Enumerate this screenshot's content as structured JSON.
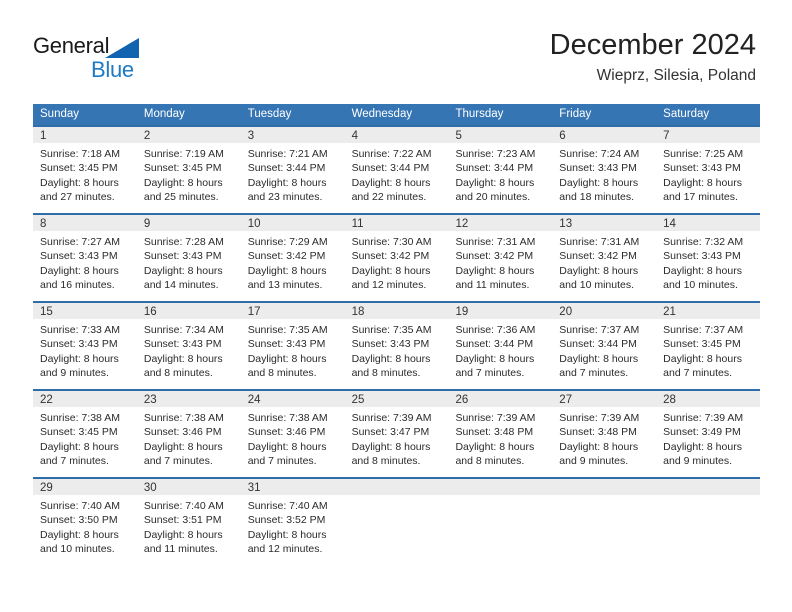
{
  "brand": {
    "name_top": "General",
    "name_bottom": "Blue",
    "accent_color": "#1f7ac4",
    "triangle_color": "#1263b0"
  },
  "header": {
    "title": "December 2024",
    "subtitle": "Wieprz, Silesia, Poland"
  },
  "calendar": {
    "header_bg": "#3575b4",
    "daynum_bg": "#ececec",
    "daynum_border": "#2f6da8",
    "weekdays": [
      "Sunday",
      "Monday",
      "Tuesday",
      "Wednesday",
      "Thursday",
      "Friday",
      "Saturday"
    ],
    "weeks": [
      [
        {
          "day": "1",
          "sunrise": "Sunrise: 7:18 AM",
          "sunset": "Sunset: 3:45 PM",
          "daylight1": "Daylight: 8 hours",
          "daylight2": "and 27 minutes."
        },
        {
          "day": "2",
          "sunrise": "Sunrise: 7:19 AM",
          "sunset": "Sunset: 3:45 PM",
          "daylight1": "Daylight: 8 hours",
          "daylight2": "and 25 minutes."
        },
        {
          "day": "3",
          "sunrise": "Sunrise: 7:21 AM",
          "sunset": "Sunset: 3:44 PM",
          "daylight1": "Daylight: 8 hours",
          "daylight2": "and 23 minutes."
        },
        {
          "day": "4",
          "sunrise": "Sunrise: 7:22 AM",
          "sunset": "Sunset: 3:44 PM",
          "daylight1": "Daylight: 8 hours",
          "daylight2": "and 22 minutes."
        },
        {
          "day": "5",
          "sunrise": "Sunrise: 7:23 AM",
          "sunset": "Sunset: 3:44 PM",
          "daylight1": "Daylight: 8 hours",
          "daylight2": "and 20 minutes."
        },
        {
          "day": "6",
          "sunrise": "Sunrise: 7:24 AM",
          "sunset": "Sunset: 3:43 PM",
          "daylight1": "Daylight: 8 hours",
          "daylight2": "and 18 minutes."
        },
        {
          "day": "7",
          "sunrise": "Sunrise: 7:25 AM",
          "sunset": "Sunset: 3:43 PM",
          "daylight1": "Daylight: 8 hours",
          "daylight2": "and 17 minutes."
        }
      ],
      [
        {
          "day": "8",
          "sunrise": "Sunrise: 7:27 AM",
          "sunset": "Sunset: 3:43 PM",
          "daylight1": "Daylight: 8 hours",
          "daylight2": "and 16 minutes."
        },
        {
          "day": "9",
          "sunrise": "Sunrise: 7:28 AM",
          "sunset": "Sunset: 3:43 PM",
          "daylight1": "Daylight: 8 hours",
          "daylight2": "and 14 minutes."
        },
        {
          "day": "10",
          "sunrise": "Sunrise: 7:29 AM",
          "sunset": "Sunset: 3:42 PM",
          "daylight1": "Daylight: 8 hours",
          "daylight2": "and 13 minutes."
        },
        {
          "day": "11",
          "sunrise": "Sunrise: 7:30 AM",
          "sunset": "Sunset: 3:42 PM",
          "daylight1": "Daylight: 8 hours",
          "daylight2": "and 12 minutes."
        },
        {
          "day": "12",
          "sunrise": "Sunrise: 7:31 AM",
          "sunset": "Sunset: 3:42 PM",
          "daylight1": "Daylight: 8 hours",
          "daylight2": "and 11 minutes."
        },
        {
          "day": "13",
          "sunrise": "Sunrise: 7:31 AM",
          "sunset": "Sunset: 3:42 PM",
          "daylight1": "Daylight: 8 hours",
          "daylight2": "and 10 minutes."
        },
        {
          "day": "14",
          "sunrise": "Sunrise: 7:32 AM",
          "sunset": "Sunset: 3:43 PM",
          "daylight1": "Daylight: 8 hours",
          "daylight2": "and 10 minutes."
        }
      ],
      [
        {
          "day": "15",
          "sunrise": "Sunrise: 7:33 AM",
          "sunset": "Sunset: 3:43 PM",
          "daylight1": "Daylight: 8 hours",
          "daylight2": "and 9 minutes."
        },
        {
          "day": "16",
          "sunrise": "Sunrise: 7:34 AM",
          "sunset": "Sunset: 3:43 PM",
          "daylight1": "Daylight: 8 hours",
          "daylight2": "and 8 minutes."
        },
        {
          "day": "17",
          "sunrise": "Sunrise: 7:35 AM",
          "sunset": "Sunset: 3:43 PM",
          "daylight1": "Daylight: 8 hours",
          "daylight2": "and 8 minutes."
        },
        {
          "day": "18",
          "sunrise": "Sunrise: 7:35 AM",
          "sunset": "Sunset: 3:43 PM",
          "daylight1": "Daylight: 8 hours",
          "daylight2": "and 8 minutes."
        },
        {
          "day": "19",
          "sunrise": "Sunrise: 7:36 AM",
          "sunset": "Sunset: 3:44 PM",
          "daylight1": "Daylight: 8 hours",
          "daylight2": "and 7 minutes."
        },
        {
          "day": "20",
          "sunrise": "Sunrise: 7:37 AM",
          "sunset": "Sunset: 3:44 PM",
          "daylight1": "Daylight: 8 hours",
          "daylight2": "and 7 minutes."
        },
        {
          "day": "21",
          "sunrise": "Sunrise: 7:37 AM",
          "sunset": "Sunset: 3:45 PM",
          "daylight1": "Daylight: 8 hours",
          "daylight2": "and 7 minutes."
        }
      ],
      [
        {
          "day": "22",
          "sunrise": "Sunrise: 7:38 AM",
          "sunset": "Sunset: 3:45 PM",
          "daylight1": "Daylight: 8 hours",
          "daylight2": "and 7 minutes."
        },
        {
          "day": "23",
          "sunrise": "Sunrise: 7:38 AM",
          "sunset": "Sunset: 3:46 PM",
          "daylight1": "Daylight: 8 hours",
          "daylight2": "and 7 minutes."
        },
        {
          "day": "24",
          "sunrise": "Sunrise: 7:38 AM",
          "sunset": "Sunset: 3:46 PM",
          "daylight1": "Daylight: 8 hours",
          "daylight2": "and 7 minutes."
        },
        {
          "day": "25",
          "sunrise": "Sunrise: 7:39 AM",
          "sunset": "Sunset: 3:47 PM",
          "daylight1": "Daylight: 8 hours",
          "daylight2": "and 8 minutes."
        },
        {
          "day": "26",
          "sunrise": "Sunrise: 7:39 AM",
          "sunset": "Sunset: 3:48 PM",
          "daylight1": "Daylight: 8 hours",
          "daylight2": "and 8 minutes."
        },
        {
          "day": "27",
          "sunrise": "Sunrise: 7:39 AM",
          "sunset": "Sunset: 3:48 PM",
          "daylight1": "Daylight: 8 hours",
          "daylight2": "and 9 minutes."
        },
        {
          "day": "28",
          "sunrise": "Sunrise: 7:39 AM",
          "sunset": "Sunset: 3:49 PM",
          "daylight1": "Daylight: 8 hours",
          "daylight2": "and 9 minutes."
        }
      ],
      [
        {
          "day": "29",
          "sunrise": "Sunrise: 7:40 AM",
          "sunset": "Sunset: 3:50 PM",
          "daylight1": "Daylight: 8 hours",
          "daylight2": "and 10 minutes."
        },
        {
          "day": "30",
          "sunrise": "Sunrise: 7:40 AM",
          "sunset": "Sunset: 3:51 PM",
          "daylight1": "Daylight: 8 hours",
          "daylight2": "and 11 minutes."
        },
        {
          "day": "31",
          "sunrise": "Sunrise: 7:40 AM",
          "sunset": "Sunset: 3:52 PM",
          "daylight1": "Daylight: 8 hours",
          "daylight2": "and 12 minutes."
        },
        {
          "day": "",
          "sunrise": "",
          "sunset": "",
          "daylight1": "",
          "daylight2": ""
        },
        {
          "day": "",
          "sunrise": "",
          "sunset": "",
          "daylight1": "",
          "daylight2": ""
        },
        {
          "day": "",
          "sunrise": "",
          "sunset": "",
          "daylight1": "",
          "daylight2": ""
        },
        {
          "day": "",
          "sunrise": "",
          "sunset": "",
          "daylight1": "",
          "daylight2": ""
        }
      ]
    ]
  }
}
